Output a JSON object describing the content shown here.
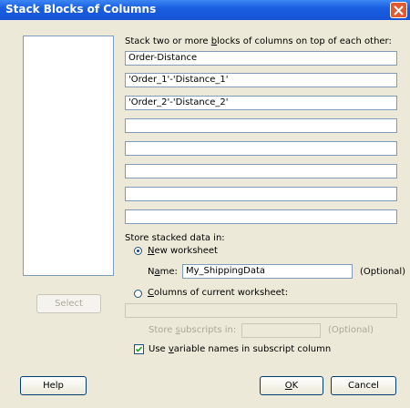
{
  "dialog": {
    "title": "Stack Blocks of Columns",
    "close_icon": "close-icon"
  },
  "instructions": {
    "pre": "Stack two or more ",
    "key": "b",
    "post": "locks of columns on top of each other:"
  },
  "blocks": [
    "Order-Distance",
    "'Order_1'-'Distance_1'",
    "'Order_2'-'Distance_2'",
    "",
    "",
    "",
    "",
    ""
  ],
  "store": {
    "heading": "Store stacked data in:",
    "new_worksheet": {
      "key": "N",
      "rest": "ew worksheet",
      "selected": true
    },
    "name": {
      "key": "a",
      "pre": "N",
      "post": "me:",
      "value": "My_ShippingData",
      "optional": "(Optional)"
    },
    "current_worksheet": {
      "key": "C",
      "rest": "olumns of current worksheet:",
      "selected": false,
      "value": ""
    },
    "subscripts": {
      "pre": "Store ",
      "key": "s",
      "post": "ubscripts in:",
      "value": "",
      "optional": "(Optional)"
    },
    "use_varnames": {
      "pre": "Use ",
      "key": "v",
      "post": "ariable names in subscript column",
      "checked": true
    }
  },
  "buttons": {
    "select": "Select",
    "help": "Help",
    "ok_key": "O",
    "ok_rest": "K",
    "cancel": "Cancel"
  }
}
